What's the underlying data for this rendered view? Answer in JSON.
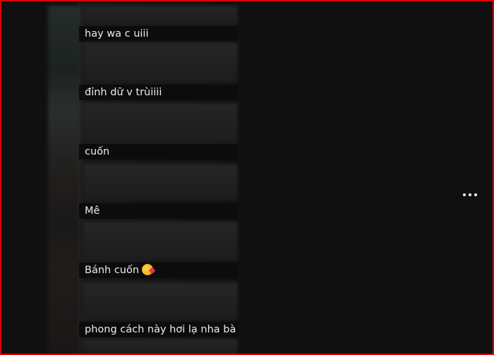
{
  "comments": [
    {
      "text": "hay wa c uiii"
    },
    {
      "text": "đỉnh dữ v trùiiii"
    },
    {
      "text": "cuốn"
    },
    {
      "text": "Mê"
    },
    {
      "text": "Bánh cuốn",
      "emoji": "smiling-face-with-hearts"
    },
    {
      "text": "phong cách này hơi lạ nha bà"
    }
  ],
  "more_options": {
    "icon": "more-horizontal-icon"
  }
}
